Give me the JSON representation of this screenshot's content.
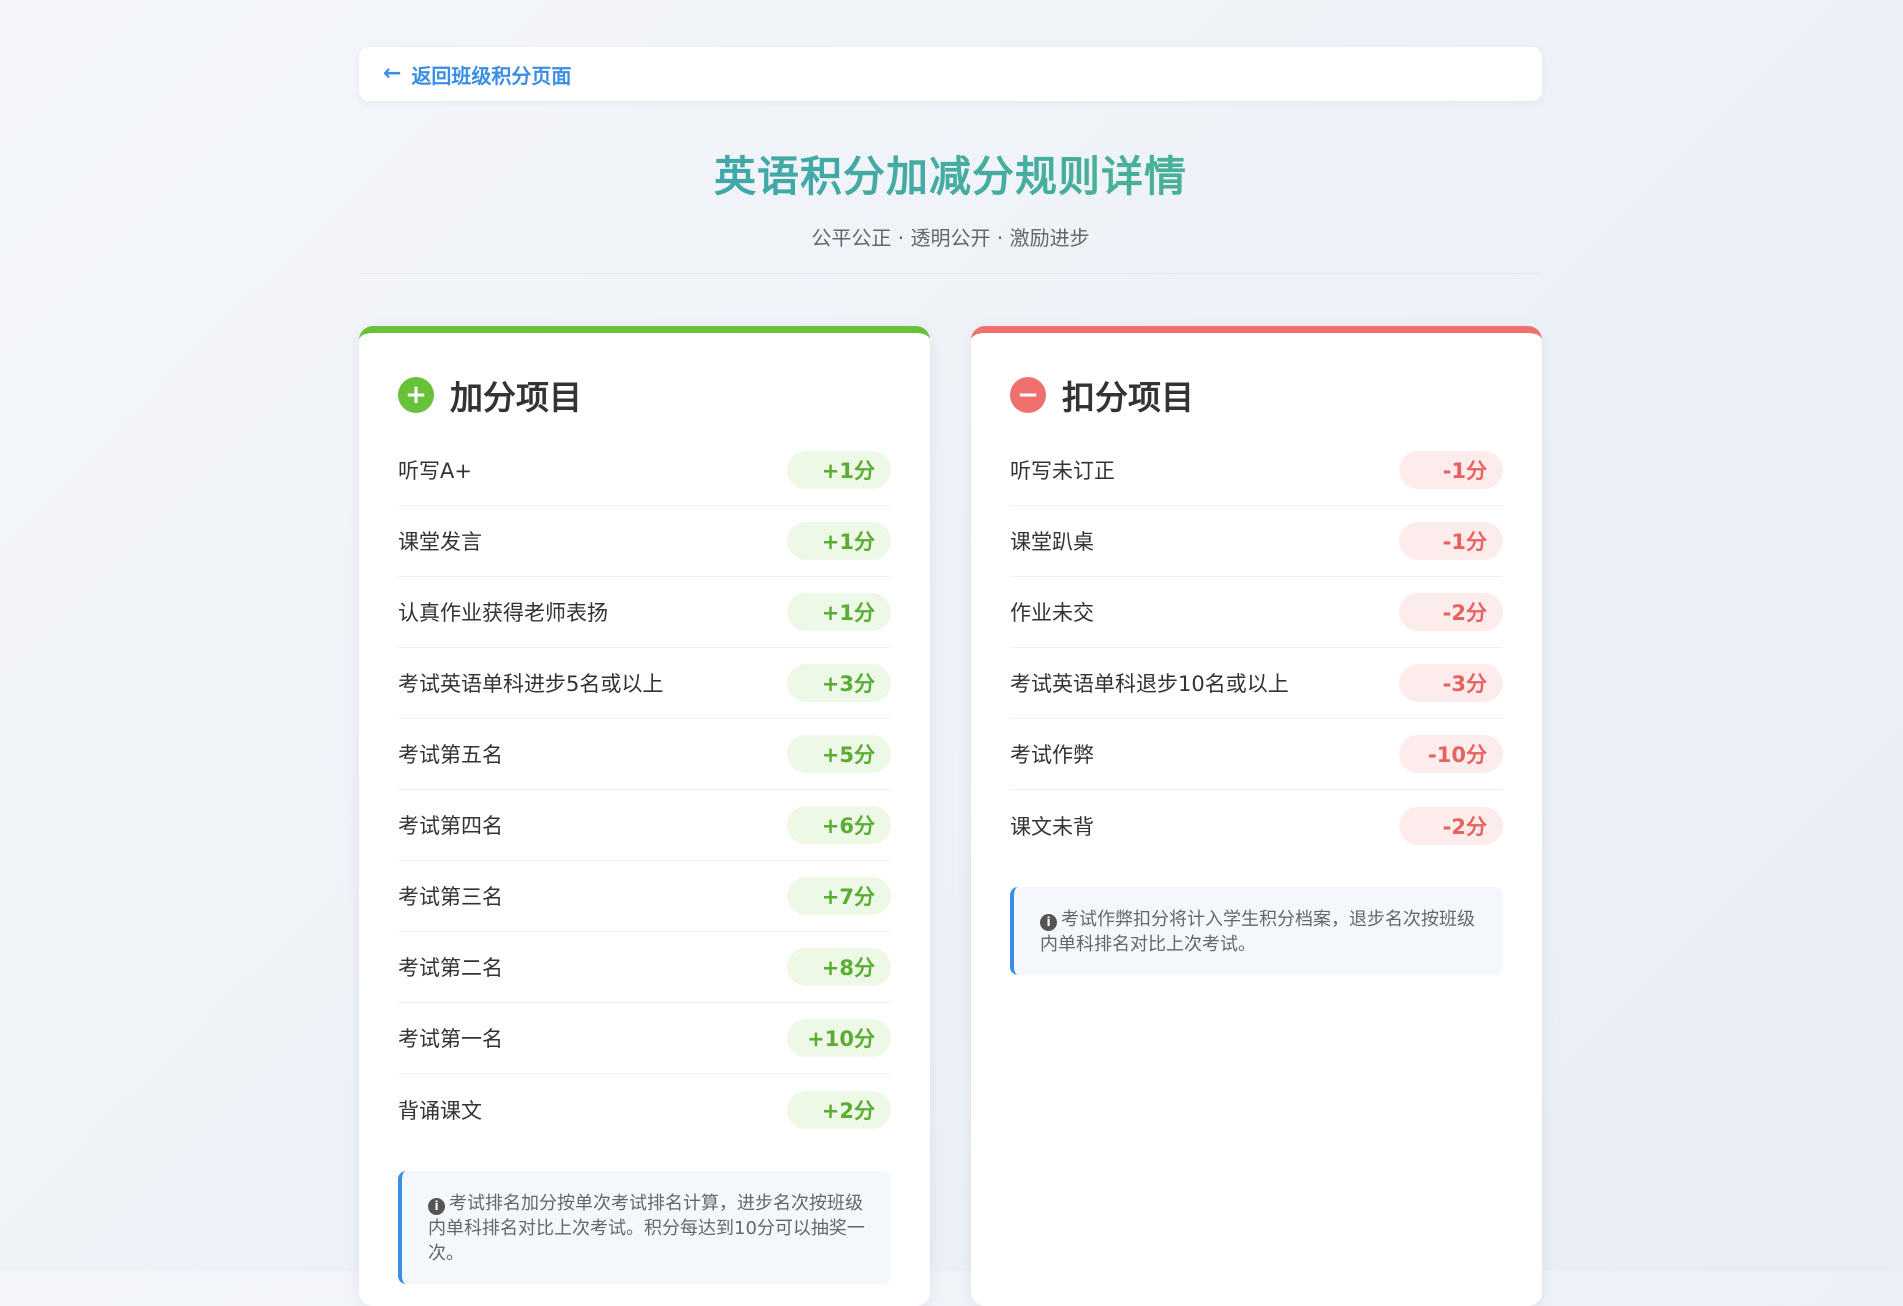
{
  "back_link": {
    "arrow": "←",
    "label": "返回班级积分页面"
  },
  "header": {
    "title": "英语积分加减分规则详情",
    "subtitle": "公平公正 · 透明公开 · 激励进步"
  },
  "add_card": {
    "icon": "+",
    "title": "加分项目",
    "rules": [
      {
        "label": "听写A+",
        "points": "+1分"
      },
      {
        "label": "课堂发言",
        "points": "+1分"
      },
      {
        "label": "认真作业获得老师表扬",
        "points": "+1分"
      },
      {
        "label": "考试英语单科进步5名或以上",
        "points": "+3分"
      },
      {
        "label": "考试第五名",
        "points": "+5分"
      },
      {
        "label": "考试第四名",
        "points": "+6分"
      },
      {
        "label": "考试第三名",
        "points": "+7分"
      },
      {
        "label": "考试第二名",
        "points": "+8分"
      },
      {
        "label": "考试第一名",
        "points": "+10分"
      },
      {
        "label": "背诵课文",
        "points": "+2分"
      }
    ],
    "note": "考试排名加分按单次考试排名计算，进步名次按班级内单科排名对比上次考试。积分每达到10分可以抽奖一次。"
  },
  "deduct_card": {
    "icon": "−",
    "title": "扣分项目",
    "rules": [
      {
        "label": "听写未订正",
        "points": "-1分"
      },
      {
        "label": "课堂趴桌",
        "points": "-1分"
      },
      {
        "label": "作业未交",
        "points": "-2分"
      },
      {
        "label": "考试英语单科退步10名或以上",
        "points": "-3分"
      },
      {
        "label": "考试作弊",
        "points": "-10分"
      },
      {
        "label": "课文未背",
        "points": "-2分"
      }
    ],
    "note": "考试作弊扣分将计入学生积分档案，退步名次按班级内单科排名对比上次考试。"
  },
  "info_icon": "i",
  "colors": {
    "accent": "#3a8ee6",
    "positive": "#67c23a",
    "negative": "#f07070"
  }
}
